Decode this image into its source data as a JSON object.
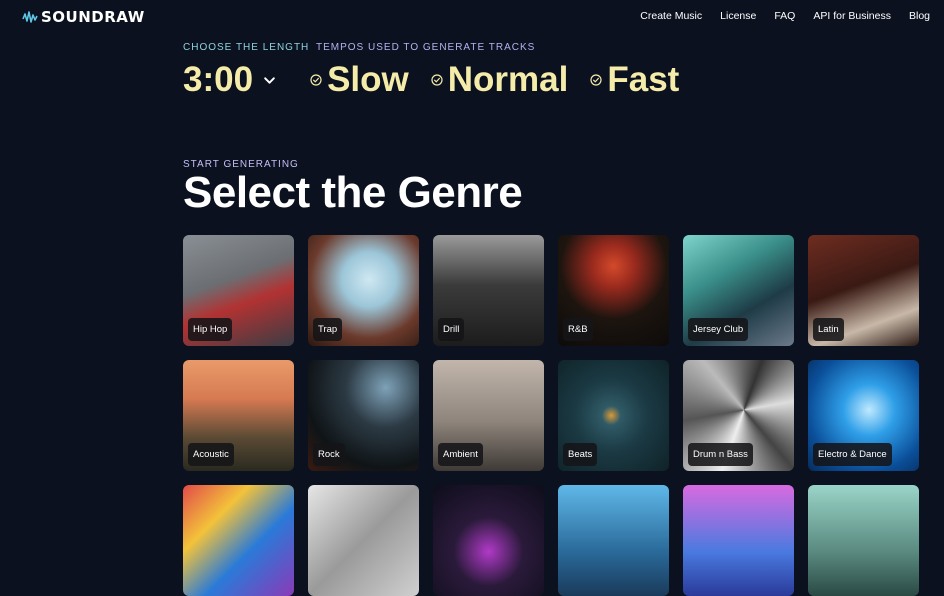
{
  "header": {
    "brand": "SOUNDRAW",
    "nav": [
      "Create Music",
      "License",
      "FAQ",
      "API for Business",
      "Blog"
    ]
  },
  "tempo_section": {
    "length_label": "CHOOSE THE LENGTH",
    "length_value": "3:00",
    "tempos_label": "TEMPOS USED TO GENERATE TRACKS",
    "tempos": [
      "Slow",
      "Normal",
      "Fast"
    ]
  },
  "genre_section": {
    "eyebrow": "START GENERATING",
    "title": "Select the Genre",
    "genres": [
      "Hip Hop",
      "Trap",
      "Drill",
      "R&B",
      "Jersey Club",
      "Latin",
      "Acoustic",
      "Rock",
      "Ambient",
      "Beats",
      "Drum n Bass",
      "Electro & Dance",
      "",
      "",
      "",
      "",
      "",
      ""
    ]
  },
  "colors": {
    "background": "#0b111e",
    "accent_yellow": "#f5ecaa",
    "eyebrow_teal": "#8fd3e0",
    "eyebrow_violet": "#b6b2f0"
  }
}
